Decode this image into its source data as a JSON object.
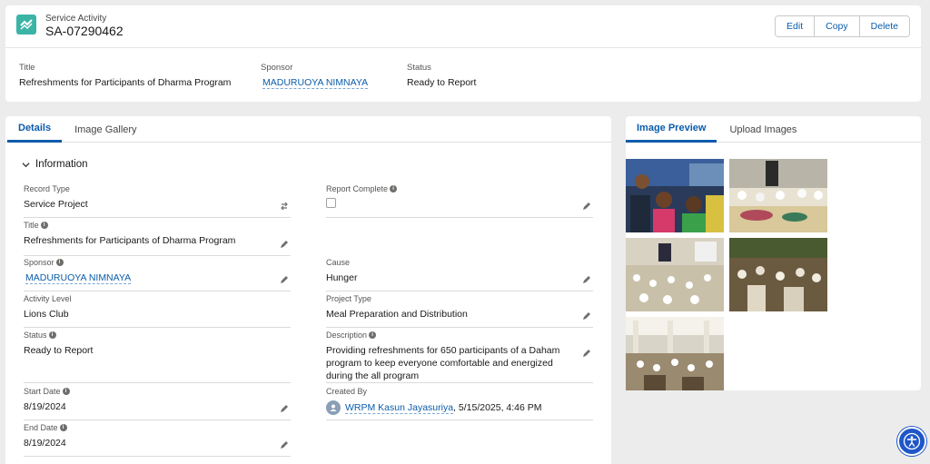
{
  "header": {
    "object_type": "Service Activity",
    "record_name": "SA-07290462",
    "actions": {
      "edit": "Edit",
      "copy": "Copy",
      "delete": "Delete"
    }
  },
  "highlights": {
    "title_label": "Title",
    "title_value": "Refreshments for Participants of Dharma Program",
    "sponsor_label": "Sponsor",
    "sponsor_value": "MADURUOYA NIMNAYA",
    "status_label": "Status",
    "status_value": "Ready to Report"
  },
  "left_tabs": [
    "Details",
    "Image Gallery"
  ],
  "section": {
    "title": "Information"
  },
  "fields": {
    "record_type": {
      "label": "Record Type",
      "value": "Service Project"
    },
    "report_complete": {
      "label": "Report Complete"
    },
    "title": {
      "label": "Title",
      "value": "Refreshments for Participants of Dharma Program"
    },
    "sponsor": {
      "label": "Sponsor",
      "value": "MADURUOYA NIMNAYA"
    },
    "cause": {
      "label": "Cause",
      "value": "Hunger"
    },
    "activity_level": {
      "label": "Activity Level",
      "value": "Lions Club"
    },
    "project_type": {
      "label": "Project Type",
      "value": "Meal Preparation and Distribution"
    },
    "status": {
      "label": "Status",
      "value": "Ready to Report"
    },
    "description": {
      "label": "Description",
      "value": "Providing refreshments for 650 participants of a Daham program to keep everyone comfortable and energized during the all program"
    },
    "start_date": {
      "label": "Start Date",
      "value": "8/19/2024"
    },
    "created_by": {
      "label": "Created By",
      "user": "WRPM Kasun Jayasuriya",
      "date": ", 5/15/2025, 4:46 PM"
    },
    "end_date": {
      "label": "End Date",
      "value": "8/19/2024"
    }
  },
  "right_tabs": [
    "Image Preview",
    "Upload Images"
  ],
  "colors": {
    "brand": "#0b5cab",
    "object_icon": "#3bb4a6",
    "accessibility": "#1f56c8"
  },
  "icons": [
    "service-activity-icon",
    "pencil-icon",
    "info-icon",
    "chevron-down-icon",
    "switch-icon",
    "user-avatar-icon",
    "accessibility-icon"
  ]
}
